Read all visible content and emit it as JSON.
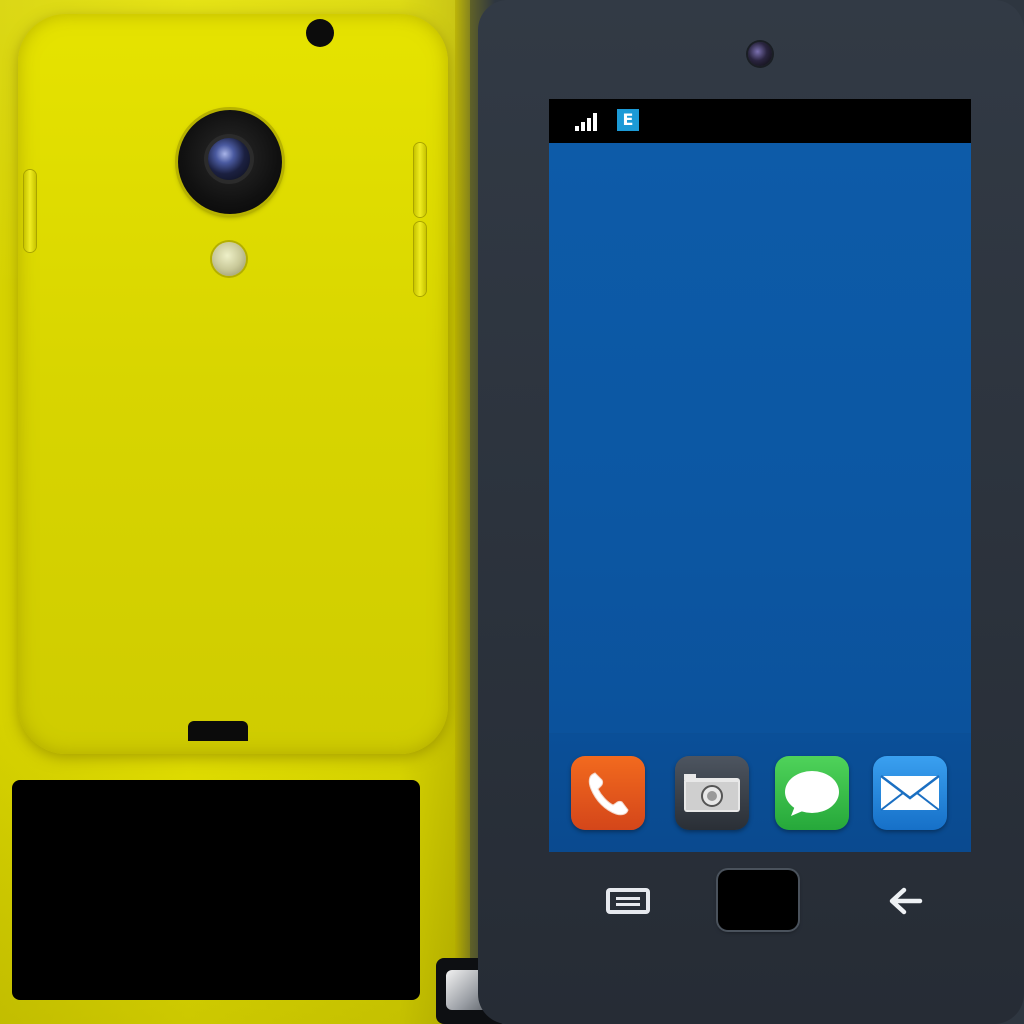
{
  "status_bar": {
    "network_type": "E",
    "signal_icon": "signal-bars-icon",
    "network_badge_color": "#1c9ad6"
  },
  "dock": {
    "apps": [
      {
        "name": "phone",
        "icon": "phone-icon",
        "color": "#e2571c"
      },
      {
        "name": "camera",
        "icon": "camera-icon",
        "color": "#3a4048"
      },
      {
        "name": "messages",
        "icon": "messages-icon",
        "color": "#36bb46"
      },
      {
        "name": "mail",
        "icon": "mail-icon",
        "color": "#2286dc"
      }
    ]
  },
  "navigation": {
    "menu_icon": "menu-icon",
    "home_icon": "home-button",
    "back_icon": "back-arrow-icon"
  },
  "colors": {
    "back_shell": "#dcd900",
    "front_bezel": "#2e3640",
    "screen_wallpaper": "#0d5aa7"
  }
}
